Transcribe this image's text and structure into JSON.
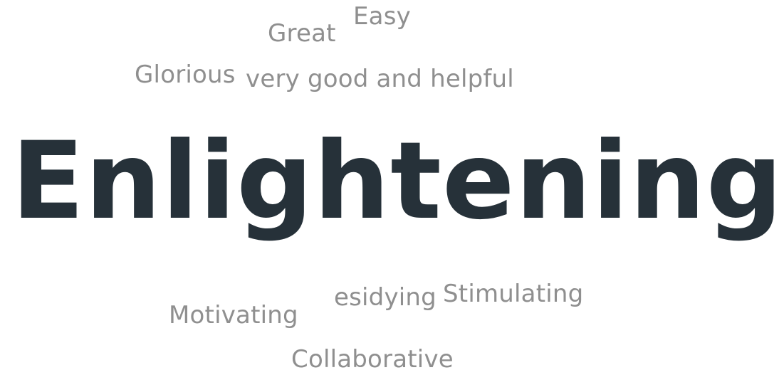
{
  "word_cloud": {
    "dominant_word": "Enlightening",
    "words": {
      "easy": "Easy",
      "great": "Great",
      "glorious": "Glorious",
      "very_good": "very good and helpful",
      "stimulating": "Stimulating",
      "esidying": "esidying",
      "motivating": "Motivating",
      "collaborative": "Collaborative"
    },
    "colors": {
      "dominant": "#263139",
      "minor": "#8f8f8f",
      "background": "#ffffff"
    }
  }
}
